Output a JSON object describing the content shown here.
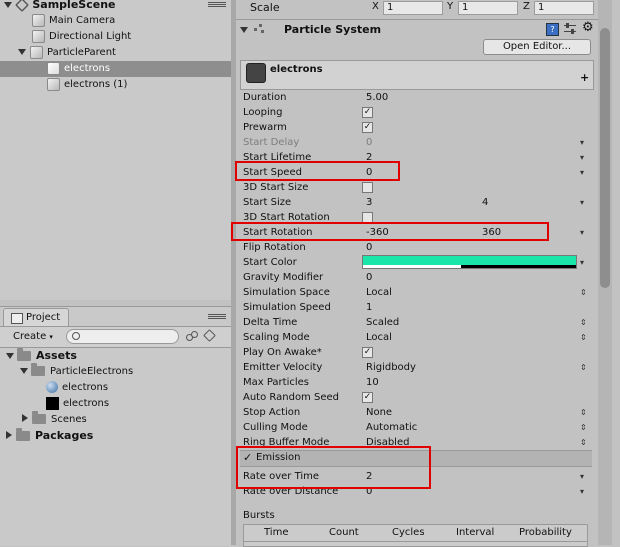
{
  "hierarchy": {
    "scene": "SampleScene",
    "items": [
      {
        "label": "Main Camera"
      },
      {
        "label": "Directional Light"
      },
      {
        "label": "ParticleParent"
      },
      {
        "label": "electrons"
      },
      {
        "label": "electrons (1)"
      }
    ]
  },
  "project": {
    "tab_label": "Project",
    "create_label": "Create",
    "search_placeholder": "",
    "tree": [
      {
        "label": "Assets"
      },
      {
        "label": "ParticleElectrons"
      },
      {
        "label": "electrons"
      },
      {
        "label": "electrons"
      },
      {
        "label": "Scenes"
      },
      {
        "label": "Packages"
      }
    ]
  },
  "inspector": {
    "scale_label": "Scale",
    "scale": {
      "x_label": "X",
      "x": "1",
      "y_label": "Y",
      "y": "1",
      "z_label": "Z",
      "z": "1"
    },
    "component_title": "Particle System",
    "open_editor": "Open Editor...",
    "system_name": "electrons",
    "plus": "+",
    "main": [
      {
        "label": "Duration",
        "value": "5.00"
      },
      {
        "label": "Looping",
        "value": "✓"
      },
      {
        "label": "Prewarm",
        "value": "✓"
      },
      {
        "label": "Start Delay",
        "value": "0"
      },
      {
        "label": "Start Lifetime",
        "value": "2"
      },
      {
        "label": "Start Speed",
        "value": "0"
      },
      {
        "label": "3D Start Size",
        "value": ""
      },
      {
        "label": "Start Size",
        "value": "3",
        "value2": "4"
      },
      {
        "label": "3D Start Rotation",
        "value": ""
      },
      {
        "label": "Start Rotation",
        "value": "-360",
        "value2": "360"
      },
      {
        "label": "Flip Rotation",
        "value": "0"
      },
      {
        "label": "Start Color",
        "value": ""
      },
      {
        "label": "Gravity Modifier",
        "value": "0"
      },
      {
        "label": "Simulation Space",
        "value": "Local"
      },
      {
        "label": "Simulation Speed",
        "value": "1"
      },
      {
        "label": "Delta Time",
        "value": "Scaled"
      },
      {
        "label": "Scaling Mode",
        "value": "Local"
      },
      {
        "label": "Play On Awake*",
        "value": "✓"
      },
      {
        "label": "Emitter Velocity",
        "value": "Rigidbody"
      },
      {
        "label": "Max Particles",
        "value": "10"
      },
      {
        "label": "Auto Random Seed",
        "value": "✓"
      },
      {
        "label": "Stop Action",
        "value": "None"
      },
      {
        "label": "Culling Mode",
        "value": "Automatic"
      },
      {
        "label": "Ring Buffer Mode",
        "value": "Disabled"
      }
    ],
    "start_color_hex": "#19e6a8",
    "emission": {
      "check": "✓",
      "title": "Emission",
      "rate_time_label": "Rate over Time",
      "rate_time": "2",
      "rate_dist_label": "Rate over Distance",
      "rate_dist": "0",
      "bursts_label": "Bursts",
      "columns": [
        "Time",
        "Count",
        "Cycles",
        "Interval",
        "Probability"
      ]
    }
  }
}
